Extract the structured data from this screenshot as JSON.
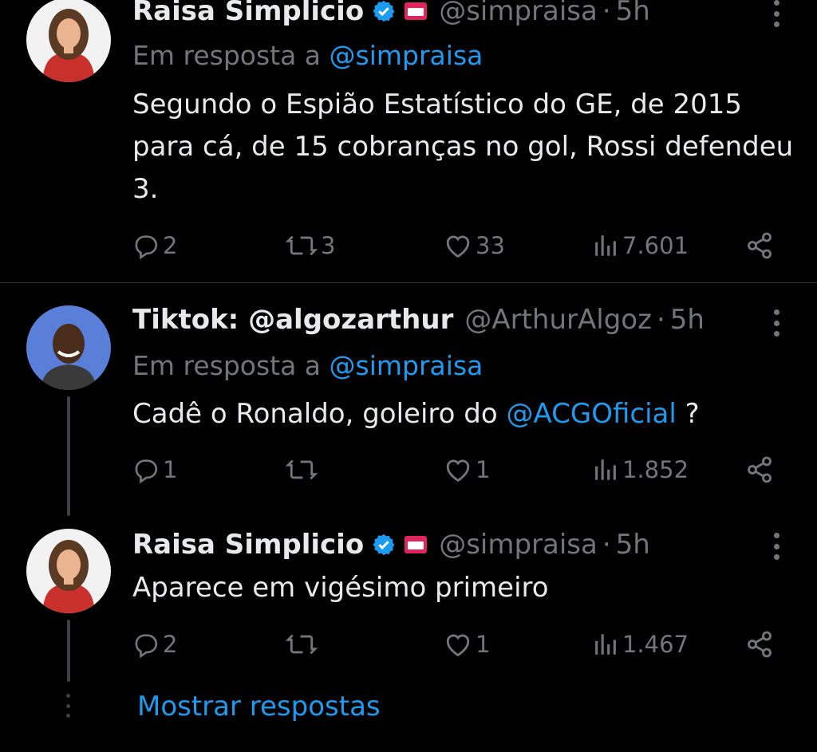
{
  "tweets": [
    {
      "name": "Raisa Simplicio",
      "handle": "@simpraisa",
      "separator": "·",
      "time": "5h",
      "replying_prefix": "Em resposta a ",
      "replying_to": "@simpraisa",
      "text": "Segundo o Espião Estatístico do GE, de 2015 para cá, de 15 cobranças no gol, Rossi defendeu 3.",
      "replies": "2",
      "retweets": "3",
      "likes": "33",
      "views": "7.601"
    },
    {
      "name": "Tiktok: @algozarthur",
      "handle": "@ArthurAlgoz",
      "separator": "·",
      "time": "5h",
      "replying_prefix": "Em resposta a ",
      "replying_to": "@simpraisa",
      "text_before": "Cadê o Ronaldo, goleiro do ",
      "text_mention": "@ACGOficial",
      "text_after": " ?",
      "replies": "1",
      "retweets": "",
      "likes": "1",
      "views": "1.852"
    },
    {
      "name": "Raisa Simplicio",
      "handle": "@simpraisa",
      "separator": "·",
      "time": "5h",
      "text": "Aparece em vigésimo primeiro",
      "replies": "2",
      "retweets": "",
      "likes": "1",
      "views": "1.467"
    }
  ],
  "show_replies": "Mostrar respostas",
  "colors": {
    "background": "#000000",
    "text": "#e7e9ea",
    "muted": "#71767b",
    "link": "#1d9bf0",
    "verified": "#1d9bf0"
  }
}
